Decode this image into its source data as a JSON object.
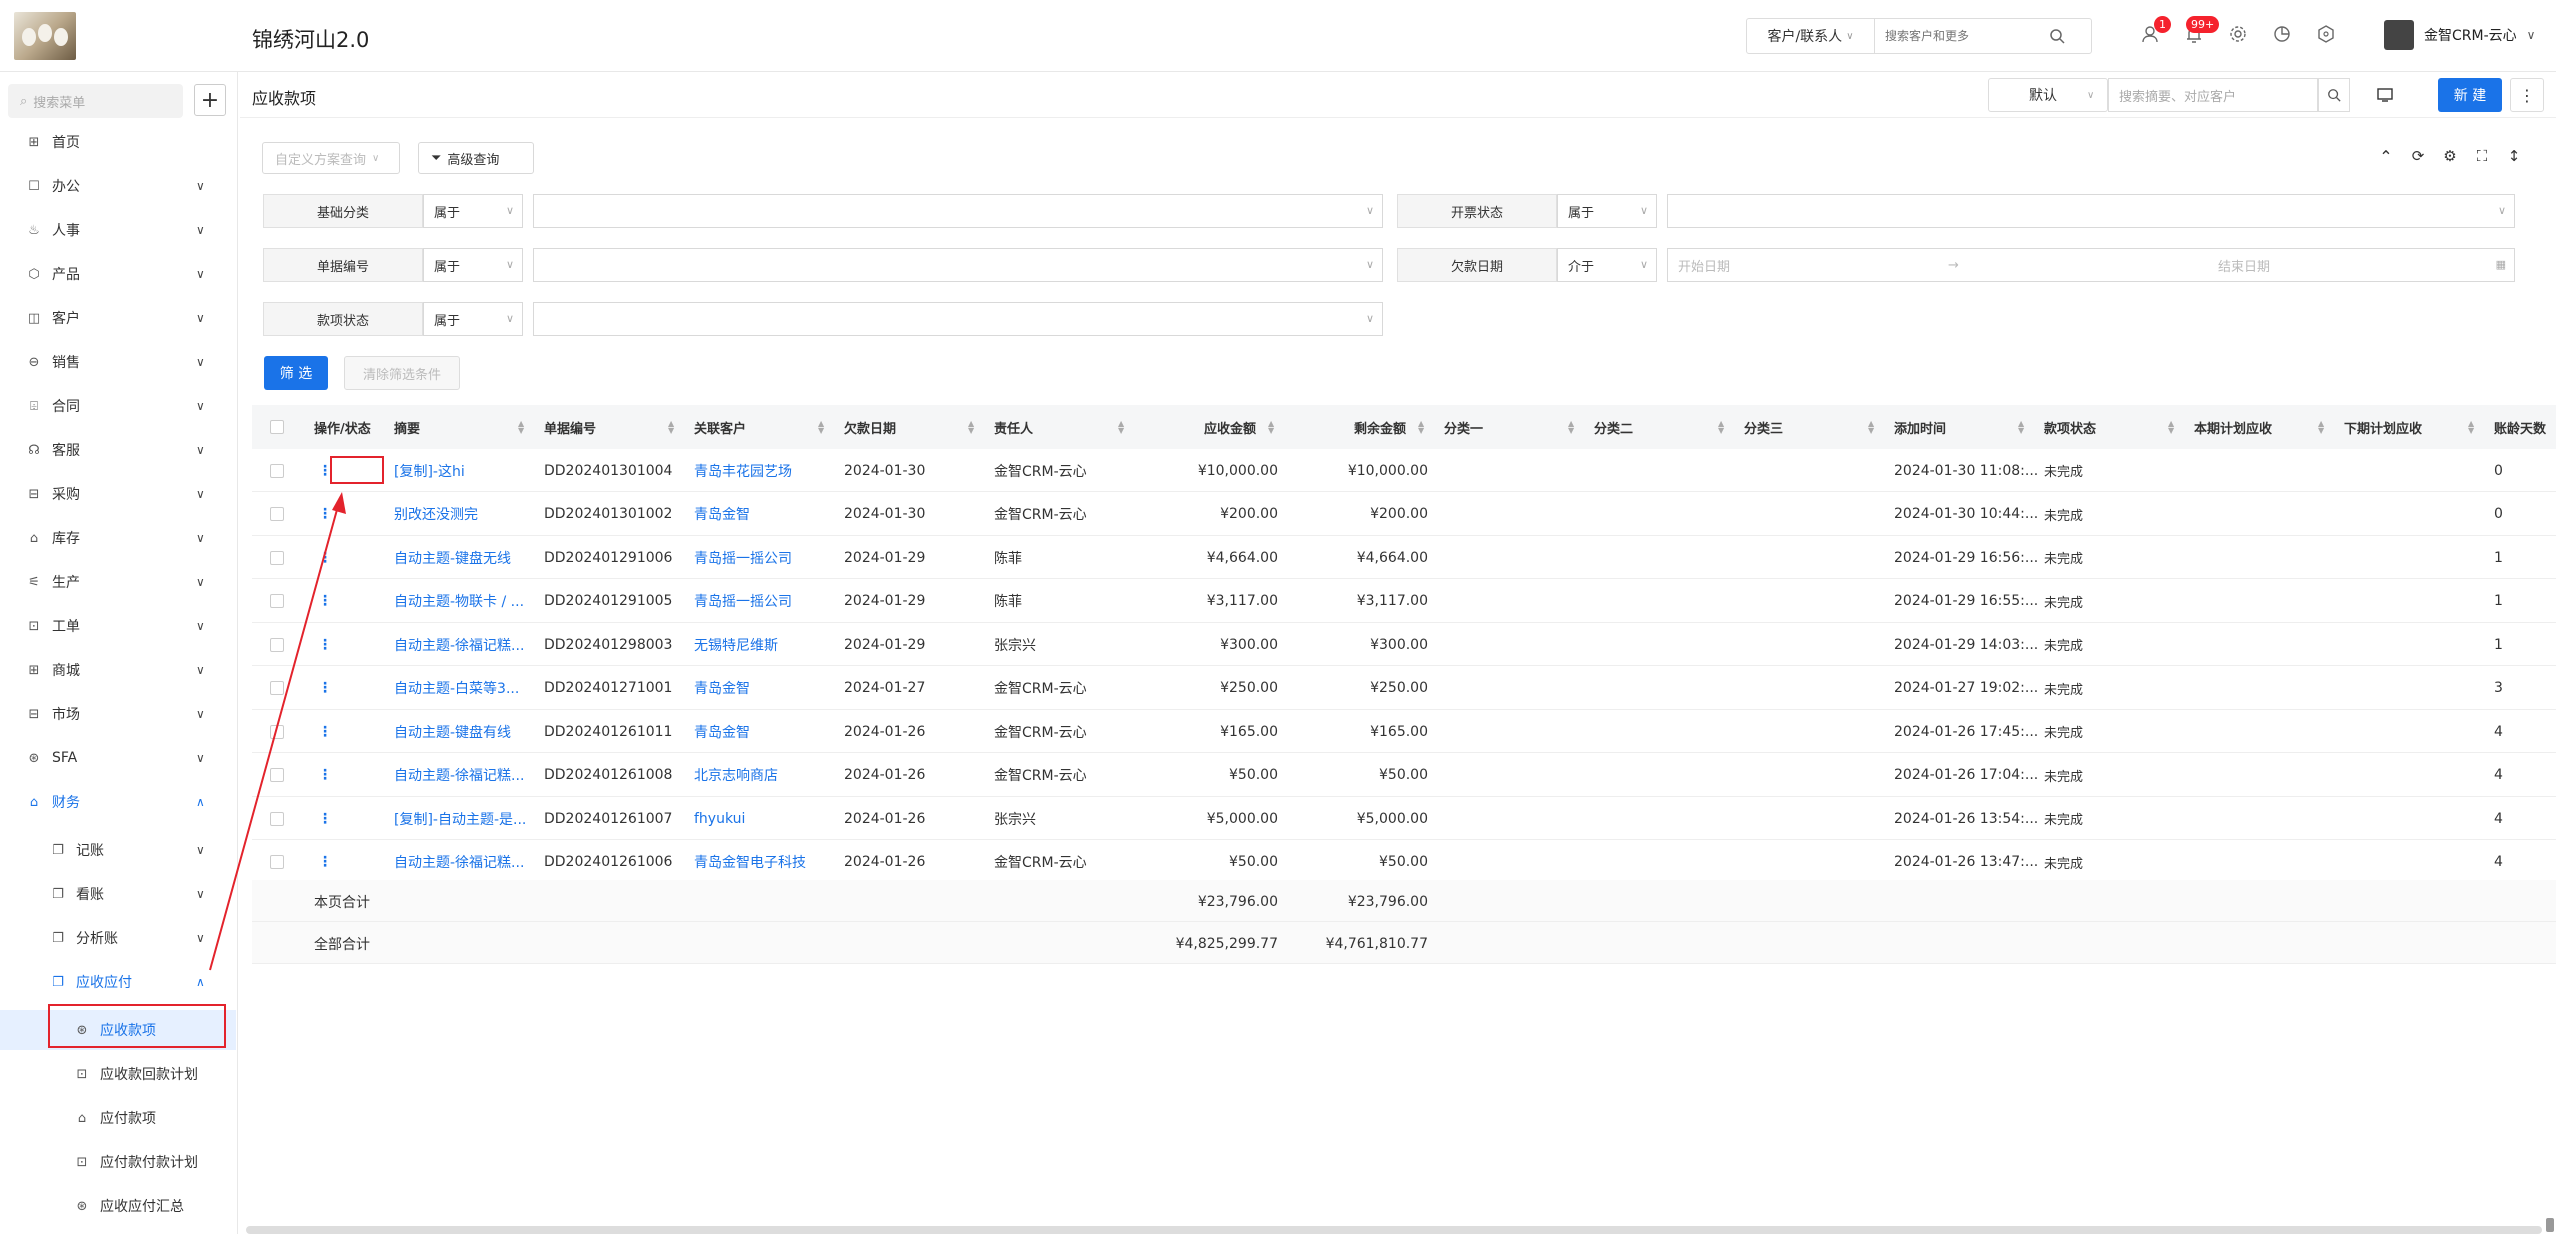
{
  "app": {
    "brand": "锦绣河山2.0"
  },
  "topbar": {
    "search_scope": "客户/联系人",
    "search_placeholder": "搜索客户和更多",
    "badge_1": "1",
    "badge_2": "99+",
    "user_name": "金智CRM-云心"
  },
  "sidebar": {
    "search_placeholder": "搜索菜单",
    "plus": "+",
    "items": [
      {
        "label": "首页",
        "icon": "⊞"
      },
      {
        "label": "办公",
        "icon": "☐"
      },
      {
        "label": "人事",
        "icon": "♨"
      },
      {
        "label": "产品",
        "icon": "⬡"
      },
      {
        "label": "客户",
        "icon": "◫"
      },
      {
        "label": "销售",
        "icon": "⊖"
      },
      {
        "label": "合同",
        "icon": "⌹"
      },
      {
        "label": "客服",
        "icon": "☊"
      },
      {
        "label": "采购",
        "icon": "⊟"
      },
      {
        "label": "库存",
        "icon": "⌂"
      },
      {
        "label": "生产",
        "icon": "⚟"
      },
      {
        "label": "工单",
        "icon": "⊡"
      },
      {
        "label": "商城",
        "icon": "⊞"
      },
      {
        "label": "市场",
        "icon": "⊟"
      },
      {
        "label": "SFA",
        "icon": "⊛"
      },
      {
        "label": "财务",
        "icon": "⌂"
      }
    ],
    "finance_sub": [
      {
        "label": "记账",
        "icon": "❐"
      },
      {
        "label": "看账",
        "icon": "❐"
      },
      {
        "label": "分析账",
        "icon": "❐"
      },
      {
        "label": "应收应付",
        "icon": "❐"
      }
    ],
    "ar_sub": [
      {
        "label": "应收款项",
        "icon": "⊛"
      },
      {
        "label": "应收款回款计划",
        "icon": "⊡"
      },
      {
        "label": "应付款项",
        "icon": "⌂"
      },
      {
        "label": "应付款付款计划",
        "icon": "⊡"
      },
      {
        "label": "应收应付汇总",
        "icon": "⊛"
      }
    ]
  },
  "page": {
    "title": "应收款项",
    "view_select": "默认",
    "search_placeholder": "搜索摘要、对应客户",
    "new_button": "新 建",
    "more": "⋮"
  },
  "toolbar": {
    "custom_query": "自定义方案查询",
    "advanced_query": "高级查询"
  },
  "filters": [
    {
      "label": "基础分类",
      "op": "属于",
      "value": ""
    },
    {
      "label": "开票状态",
      "op": "属于",
      "value": ""
    },
    {
      "label": "单据编号",
      "op": "属于",
      "value": ""
    },
    {
      "label": "欠款日期",
      "op": "介于",
      "start": "开始日期",
      "arrow": "→",
      "end": "结束日期"
    },
    {
      "label": "款项状态",
      "op": "属于",
      "value": ""
    }
  ],
  "filter_buttons": {
    "apply": "筛 选",
    "clear": "清除筛选条件"
  },
  "table": {
    "columns": [
      "操作/状态",
      "摘要",
      "单据编号",
      "关联客户",
      "欠款日期",
      "责任人",
      "应收金额",
      "剩余金额",
      "分类一",
      "分类二",
      "分类三",
      "添加时间",
      "款项状态",
      "本期计划应收",
      "下期计划应收",
      "账龄天数"
    ],
    "rows": [
      {
        "summary": "[复制]-这hi",
        "code": "DD202401301004",
        "customer": "青岛丰花园艺场",
        "date": "2024-01-30",
        "owner": "金智CRM-云心",
        "amount": "¥10,000.00",
        "remain": "¥10,000.00",
        "added": "2024-01-30 11:08:...",
        "status": "未完成",
        "age": "0"
      },
      {
        "summary": "别改还没测完",
        "code": "DD202401301002",
        "customer": "青岛金智",
        "date": "2024-01-30",
        "owner": "金智CRM-云心",
        "amount": "¥200.00",
        "remain": "¥200.00",
        "added": "2024-01-30 10:44:...",
        "status": "未完成",
        "age": "0"
      },
      {
        "summary": "自动主题-键盘无线",
        "code": "DD202401291006",
        "customer": "青岛摇一摇公司",
        "date": "2024-01-29",
        "owner": "陈菲",
        "amount": "¥4,664.00",
        "remain": "¥4,664.00",
        "added": "2024-01-29 16:56:...",
        "status": "未完成",
        "age": "1"
      },
      {
        "summary": "自动主题-物联卡 / ...",
        "code": "DD202401291005",
        "customer": "青岛摇一摇公司",
        "date": "2024-01-29",
        "owner": "陈菲",
        "amount": "¥3,117.00",
        "remain": "¥3,117.00",
        "added": "2024-01-29 16:55:...",
        "status": "未完成",
        "age": "1"
      },
      {
        "summary": "自动主题-徐福记糕...",
        "code": "DD202401298003",
        "customer": "无锡特尼维斯",
        "date": "2024-01-29",
        "owner": "张宗兴",
        "amount": "¥300.00",
        "remain": "¥300.00",
        "added": "2024-01-29 14:03:...",
        "status": "未完成",
        "age": "1"
      },
      {
        "summary": "自动主题-白菜等3...",
        "code": "DD202401271001",
        "customer": "青岛金智",
        "date": "2024-01-27",
        "owner": "金智CRM-云心",
        "amount": "¥250.00",
        "remain": "¥250.00",
        "added": "2024-01-27 19:02:...",
        "status": "未完成",
        "age": "3"
      },
      {
        "summary": "自动主题-键盘有线",
        "code": "DD202401261011",
        "customer": "青岛金智",
        "date": "2024-01-26",
        "owner": "金智CRM-云心",
        "amount": "¥165.00",
        "remain": "¥165.00",
        "added": "2024-01-26 17:45:...",
        "status": "未完成",
        "age": "4"
      },
      {
        "summary": "自动主题-徐福记糕...",
        "code": "DD202401261008",
        "customer": "北京志响商店",
        "date": "2024-01-26",
        "owner": "金智CRM-云心",
        "amount": "¥50.00",
        "remain": "¥50.00",
        "added": "2024-01-26 17:04:...",
        "status": "未完成",
        "age": "4"
      },
      {
        "summary": "[复制]-自动主题-是...",
        "code": "DD202401261007",
        "customer": "fhyukui",
        "date": "2024-01-26",
        "owner": "张宗兴",
        "amount": "¥5,000.00",
        "remain": "¥5,000.00",
        "added": "2024-01-26 13:54:...",
        "status": "未完成",
        "age": "4"
      },
      {
        "summary": "自动主题-徐福记糕...",
        "code": "DD202401261006",
        "customer": "青岛金智电子科技",
        "date": "2024-01-26",
        "owner": "金智CRM-云心",
        "amount": "¥50.00",
        "remain": "¥50.00",
        "added": "2024-01-26 13:47:...",
        "status": "未完成",
        "age": "4"
      }
    ],
    "page_total": {
      "label": "本页合计",
      "amount": "¥23,796.00",
      "remain": "¥23,796.00"
    },
    "all_total": {
      "label": "全部合计",
      "amount": "¥4,825,299.77",
      "remain": "¥4,761,810.77"
    }
  },
  "colors": {
    "accent": "#1a73e8",
    "annotation_red": "#e3232c"
  }
}
